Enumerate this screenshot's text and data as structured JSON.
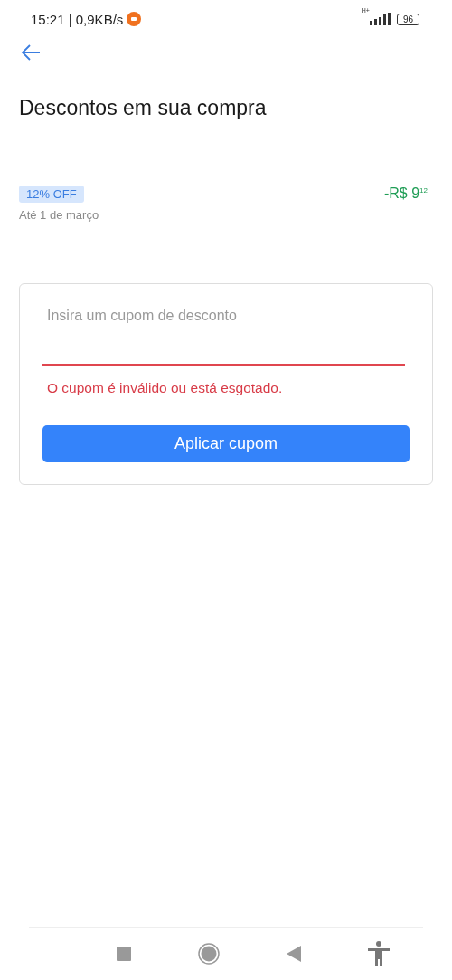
{
  "status_bar": {
    "time": "15:21 | 0,9KB/s",
    "network": "H+",
    "battery": "96"
  },
  "header": {
    "title": "Descontos em sua compra"
  },
  "discount": {
    "badge": "12% OFF",
    "validity": "Até 1 de março",
    "amount": "-R$ 9$^{12}$"
  },
  "coupon": {
    "placeholder": "Insira um cupom de desconto",
    "error": "O cupom é inválido ou está esgotado.",
    "button": "Aplicar cupom"
  }
}
